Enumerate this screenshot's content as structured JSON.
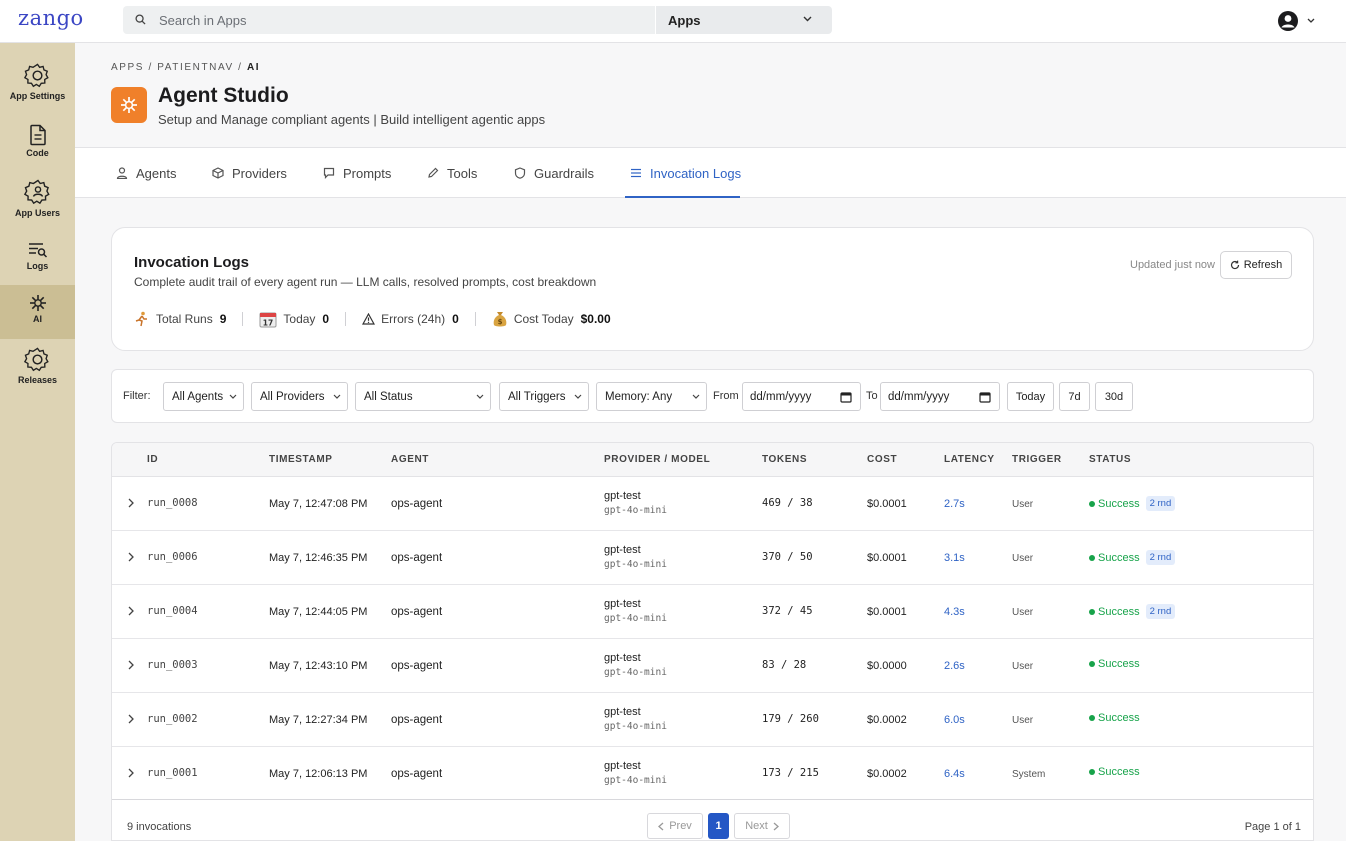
{
  "topbar": {
    "logo": "zango",
    "search_placeholder": "Search in Apps",
    "apps_select": "Apps"
  },
  "sidebar": {
    "items": [
      {
        "label": "App Settings",
        "icon": "gear-icon"
      },
      {
        "label": "Code",
        "icon": "file-icon"
      },
      {
        "label": "App Users",
        "icon": "users-gear-icon"
      },
      {
        "label": "Logs",
        "icon": "logs-search-icon"
      },
      {
        "label": "AI",
        "icon": "ai-sparkle-icon",
        "active": true
      },
      {
        "label": "Releases",
        "icon": "gear-icon"
      }
    ]
  },
  "header": {
    "breadcrumb": [
      "APPS",
      "PATIENTNAV",
      "AI"
    ],
    "title": "Agent Studio",
    "subtitle": "Setup and Manage compliant agents | Build intelligent agentic apps"
  },
  "tabs": [
    {
      "label": "Agents",
      "icon": "person-icon"
    },
    {
      "label": "Providers",
      "icon": "cube-icon"
    },
    {
      "label": "Prompts",
      "icon": "chat-icon"
    },
    {
      "label": "Tools",
      "icon": "pencil-icon"
    },
    {
      "label": "Guardrails",
      "icon": "shield-icon"
    },
    {
      "label": "Invocation Logs",
      "icon": "list-icon",
      "active": true
    }
  ],
  "summary": {
    "title": "Invocation Logs",
    "subtitle": "Complete audit trail of every agent run — LLM calls, resolved prompts, cost breakdown",
    "updated": "Updated just now",
    "refresh_label": "Refresh",
    "stats": [
      {
        "label": "Total Runs",
        "value": "9",
        "icon": "runner-icon"
      },
      {
        "label": "Today",
        "value": "0",
        "icon": "calendar-icon"
      },
      {
        "label": "Errors (24h)",
        "value": "0",
        "icon": "warning-icon"
      },
      {
        "label": "Cost Today",
        "value": "$0.00",
        "icon": "money-bag-icon"
      }
    ]
  },
  "filters": {
    "label": "Filter:",
    "agents": "All Agents",
    "providers": "All Providers",
    "status": "All Status",
    "triggers": "All Triggers",
    "memory": "Memory: Any",
    "from_label": "From",
    "from_value": "dd/mm/yyyy",
    "to_label": "To",
    "to_value": "dd/mm/yyyy",
    "btn_today": "Today",
    "btn_7d": "7d",
    "btn_30d": "30d"
  },
  "table": {
    "columns": [
      "ID",
      "TIMESTAMP",
      "AGENT",
      "PROVIDER / MODEL",
      "TOKENS",
      "COST",
      "LATENCY",
      "TRIGGER",
      "STATUS"
    ],
    "rows": [
      {
        "id": "run_0008",
        "timestamp": "May 7, 12:47:08 PM",
        "agent": "ops-agent",
        "provider": "gpt-test",
        "model": "gpt-4o-mini",
        "tokens": "469 / 38",
        "cost": "$0.0001",
        "latency": "2.7s",
        "trigger": "User",
        "status": "Success",
        "badge": "2 rnd"
      },
      {
        "id": "run_0006",
        "timestamp": "May 7, 12:46:35 PM",
        "agent": "ops-agent",
        "provider": "gpt-test",
        "model": "gpt-4o-mini",
        "tokens": "370 / 50",
        "cost": "$0.0001",
        "latency": "3.1s",
        "trigger": "User",
        "status": "Success",
        "badge": "2 rnd"
      },
      {
        "id": "run_0004",
        "timestamp": "May 7, 12:44:05 PM",
        "agent": "ops-agent",
        "provider": "gpt-test",
        "model": "gpt-4o-mini",
        "tokens": "372 / 45",
        "cost": "$0.0001",
        "latency": "4.3s",
        "trigger": "User",
        "status": "Success",
        "badge": "2 rnd"
      },
      {
        "id": "run_0003",
        "timestamp": "May 7, 12:43:10 PM",
        "agent": "ops-agent",
        "provider": "gpt-test",
        "model": "gpt-4o-mini",
        "tokens": "83 / 28",
        "cost": "$0.0000",
        "latency": "2.6s",
        "trigger": "User",
        "status": "Success",
        "badge": ""
      },
      {
        "id": "run_0002",
        "timestamp": "May 7, 12:27:34 PM",
        "agent": "ops-agent",
        "provider": "gpt-test",
        "model": "gpt-4o-mini",
        "tokens": "179 / 260",
        "cost": "$0.0002",
        "latency": "6.0s",
        "trigger": "User",
        "status": "Success",
        "badge": ""
      },
      {
        "id": "run_0001",
        "timestamp": "May 7, 12:06:13 PM",
        "agent": "ops-agent",
        "provider": "gpt-test",
        "model": "gpt-4o-mini",
        "tokens": "173 / 215",
        "cost": "$0.0002",
        "latency": "6.4s",
        "trigger": "System",
        "status": "Success",
        "badge": ""
      }
    ]
  },
  "pagination": {
    "count": "9 invocations",
    "prev": "Prev",
    "current": "1",
    "next": "Next",
    "page_of": "Page 1 of 1"
  },
  "colors": {
    "accent": "#2f63c5",
    "success": "#17a34a",
    "sidebar": "#ddd3b4",
    "studio_icon": "#f0802a"
  }
}
